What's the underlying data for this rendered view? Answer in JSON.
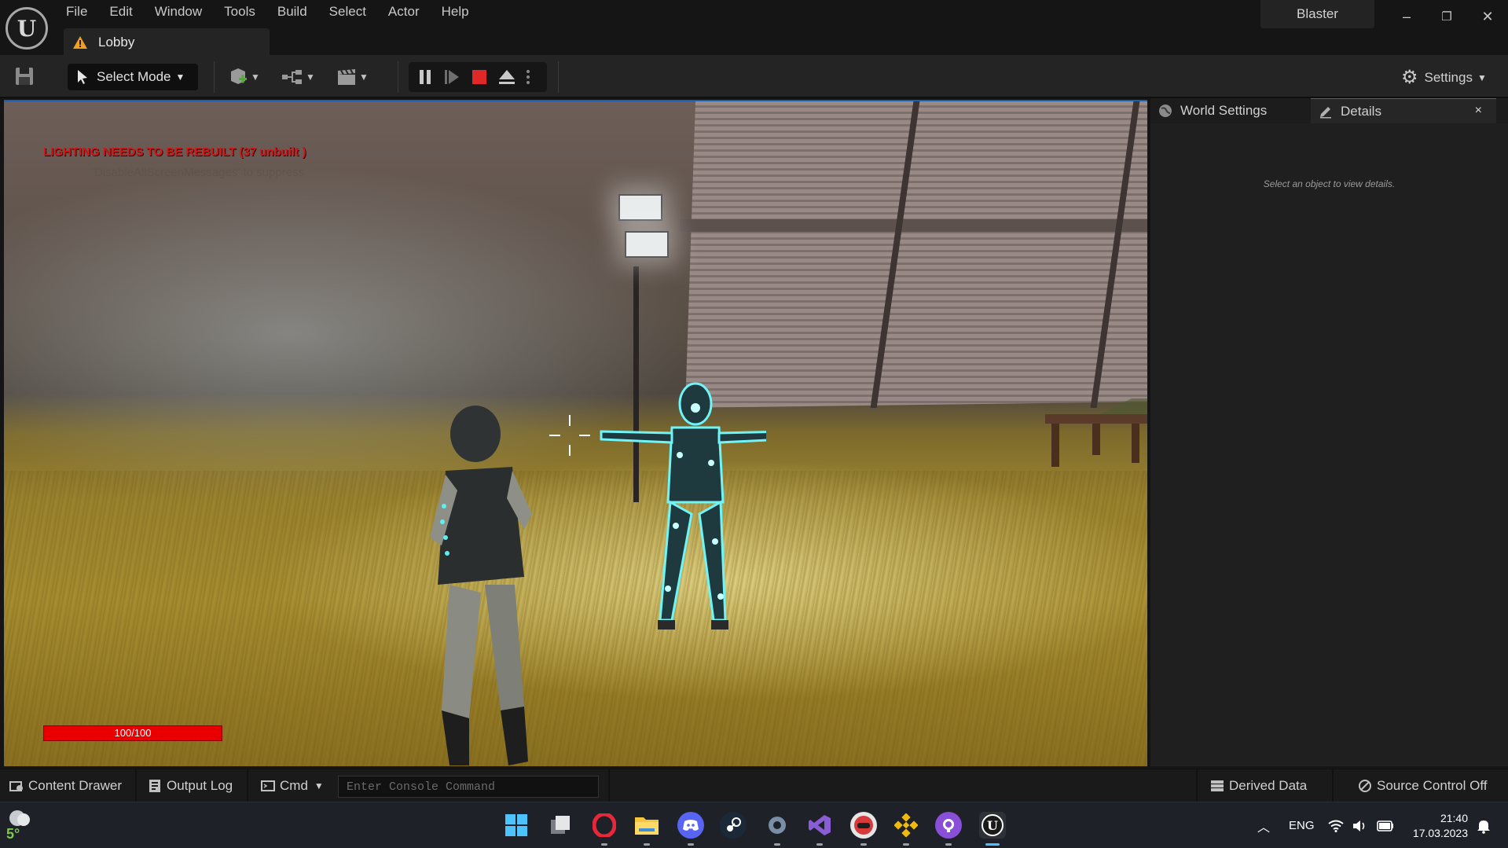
{
  "app": {
    "logo": "U"
  },
  "menu": [
    "File",
    "Edit",
    "Window",
    "Tools",
    "Build",
    "Select",
    "Actor",
    "Help"
  ],
  "tab": {
    "name": "Lobby",
    "icon": "warning-triangle-icon"
  },
  "project_name": "Blaster",
  "window_controls": {
    "minimize": "–",
    "restore": "❐",
    "close": "✕"
  },
  "toolbar": {
    "select_mode": "Select Mode",
    "settings": "Settings"
  },
  "viewport": {
    "warning": "LIGHTING NEEDS TO BE REBUILT (37 unbuilt )",
    "sub_message": "'DisableAllScreenMessages' to suppress",
    "health_text": "100/100",
    "health_fraction": 1.0
  },
  "right_panel": {
    "tab_world": "World Settings",
    "tab_details": "Details",
    "close": "×",
    "empty_message": "Select an object to view details."
  },
  "statusbar": {
    "content_drawer": "Content Drawer",
    "output_log": "Output Log",
    "cmd": "Cmd",
    "console_placeholder": "Enter Console Command",
    "derived_data": "Derived Data",
    "source_control": "Source Control Off"
  },
  "taskbar": {
    "weather_temp": "5°",
    "language": "ENG",
    "time": "21:40",
    "date": "17.03.2023"
  },
  "colors": {
    "accent": "#1f6ad4",
    "warning_text": "#d01818",
    "health": "#e80000"
  }
}
